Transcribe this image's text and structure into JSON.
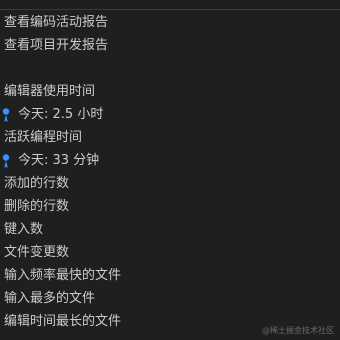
{
  "menu": {
    "view_coding_report": "查看编码活动报告",
    "view_project_report": "查看项目开发报告",
    "editor_usage_time": "编辑器使用时间",
    "editor_usage_today": "今天: 2.5 小时",
    "active_coding_time": "活跃编程时间",
    "active_coding_today": "今天: 33 分钟",
    "lines_added": "添加的行数",
    "lines_deleted": "删除的行数",
    "keystrokes": "键入数",
    "file_changes": "文件变更数",
    "fastest_typing_files": "输入频率最快的文件",
    "most_typed_files": "输入最多的文件",
    "longest_edit_files": "编辑时间最长的文件"
  },
  "icons": {
    "pin_color": "#3794ff"
  },
  "watermark": "@稀土掘金技术社区"
}
